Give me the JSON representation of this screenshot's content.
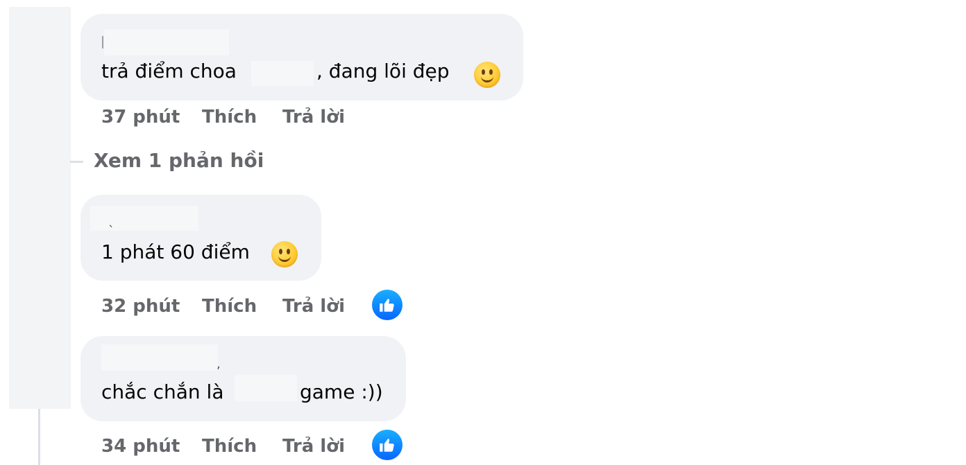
{
  "comments": [
    {
      "text_before": "trả điểm choa",
      "text_after": ", đang lõi đẹp",
      "emoji": "slightly-smiling-face-icon",
      "time": "37 phút",
      "like_label": "Thích",
      "reply_label": "Trả lời",
      "has_reaction": false
    },
    {
      "text_before": "1 phát 60 điểm",
      "text_after": "",
      "emoji": "slightly-smiling-face-icon",
      "time": "32 phút",
      "like_label": "Thích",
      "reply_label": "Trả lời",
      "has_reaction": true,
      "reaction_icon": "like-reaction-icon"
    },
    {
      "text_before": "chắc chắn là",
      "text_after": "game :))",
      "time": "34 phút",
      "like_label": "Thích",
      "reply_label": "Trả lời",
      "has_reaction": true,
      "reaction_icon": "like-reaction-icon"
    }
  ],
  "view_replies_label": "Xem 1 phản hồi",
  "colors": {
    "bubble": "#f0f2f5",
    "meta_text": "#65676b",
    "like_blue": "#0866ff"
  }
}
